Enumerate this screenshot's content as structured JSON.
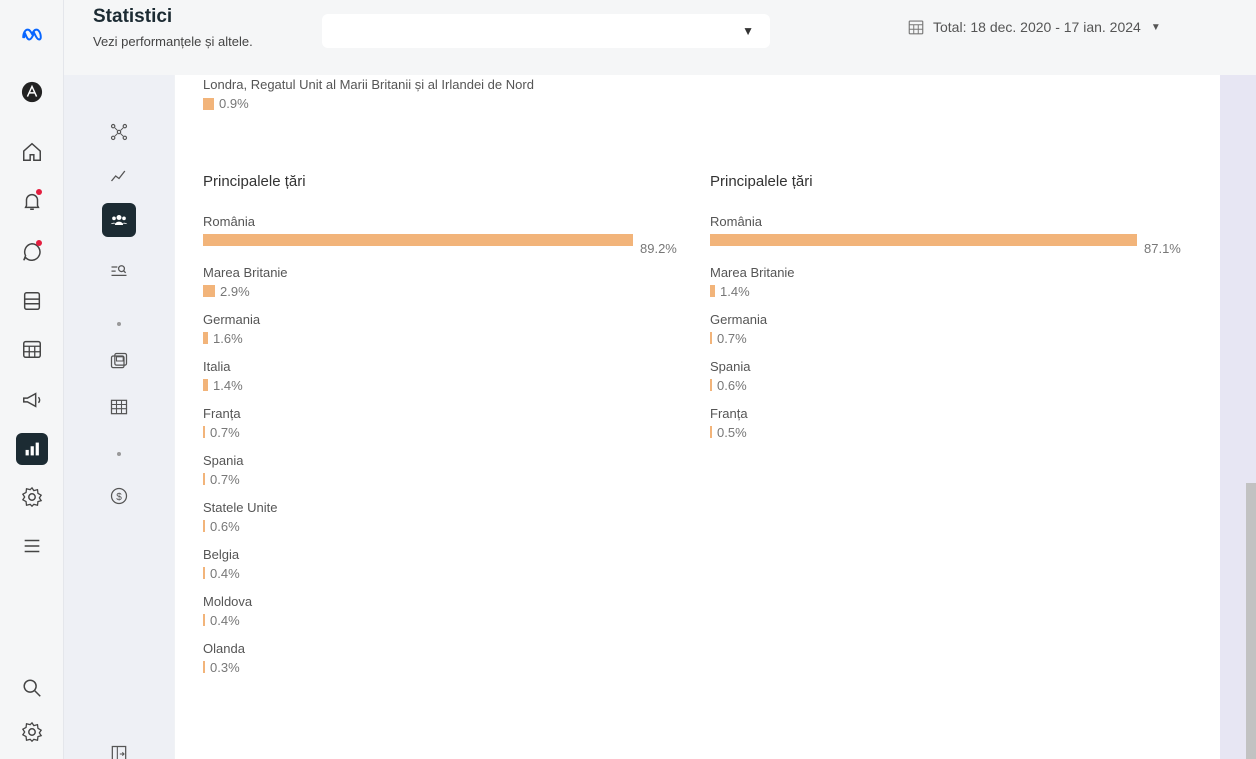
{
  "header": {
    "title": "Statistici",
    "subtitle": "Vezi performanțele și altele.",
    "account_selector": "",
    "date_range": "Total: 18 dec. 2020 - 17 ian. 2024"
  },
  "top_city": {
    "name": "Londra, Regatul Unit al Marii Britanii și al Irlandei de Nord",
    "percent": "0.9%",
    "value": 0.9
  },
  "left_column": {
    "title": "Principalele țări",
    "countries": [
      {
        "name": "România",
        "percent": "89.2%",
        "value": 89.2
      },
      {
        "name": "Marea Britanie",
        "percent": "2.9%",
        "value": 2.9
      },
      {
        "name": "Germania",
        "percent": "1.6%",
        "value": 1.6
      },
      {
        "name": "Italia",
        "percent": "1.4%",
        "value": 1.4
      },
      {
        "name": "Franța",
        "percent": "0.7%",
        "value": 0.7
      },
      {
        "name": "Spania",
        "percent": "0.7%",
        "value": 0.7
      },
      {
        "name": "Statele Unite",
        "percent": "0.6%",
        "value": 0.6
      },
      {
        "name": "Belgia",
        "percent": "0.4%",
        "value": 0.4
      },
      {
        "name": "Moldova",
        "percent": "0.4%",
        "value": 0.4
      },
      {
        "name": "Olanda",
        "percent": "0.3%",
        "value": 0.3
      }
    ]
  },
  "right_column": {
    "title": "Principalele țări",
    "countries": [
      {
        "name": "România",
        "percent": "87.1%",
        "value": 87.1
      },
      {
        "name": "Marea Britanie",
        "percent": "1.4%",
        "value": 1.4
      },
      {
        "name": "Germania",
        "percent": "0.7%",
        "value": 0.7
      },
      {
        "name": "Spania",
        "percent": "0.6%",
        "value": 0.6
      },
      {
        "name": "Franța",
        "percent": "0.5%",
        "value": 0.5
      }
    ]
  },
  "colors": {
    "bar": "#f2b47a",
    "active_nav": "#1c2b33",
    "notification_dot": "#e41e3f"
  },
  "rail_icons": [
    "meta-logo-icon",
    "account-avatar-icon",
    "home-icon",
    "notifications-icon",
    "messages-icon",
    "content-icon",
    "planner-icon",
    "ads-icon",
    "insights-icon",
    "settings-icon",
    "menu-icon",
    "search-icon",
    "help-settings-icon"
  ],
  "subnav_icons": [
    "overview-icon",
    "trends-icon",
    "audience-icon",
    "content-search-icon",
    "posts-icon",
    "table-icon",
    "monetization-icon",
    "export-icon"
  ]
}
